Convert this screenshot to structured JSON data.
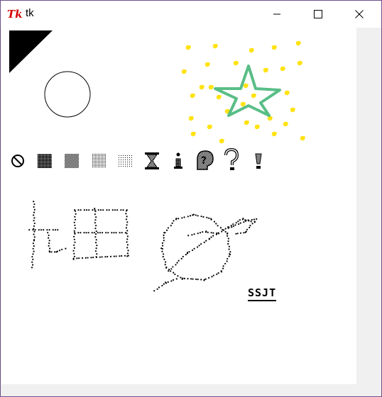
{
  "window": {
    "title": "tk",
    "icon": "tk-feather-icon",
    "controls": [
      "minimize-icon",
      "maximize-icon",
      "close-icon"
    ]
  },
  "canvas": {
    "text_label": "SSJT",
    "bitmaps": [
      "error",
      "gray75",
      "gray50",
      "gray25",
      "gray12",
      "hourglass",
      "info",
      "questhead",
      "question",
      "warning"
    ]
  },
  "colors": {
    "star_outline": "#3cb371",
    "star_dots": "#ffe000",
    "ink": "#000000"
  }
}
